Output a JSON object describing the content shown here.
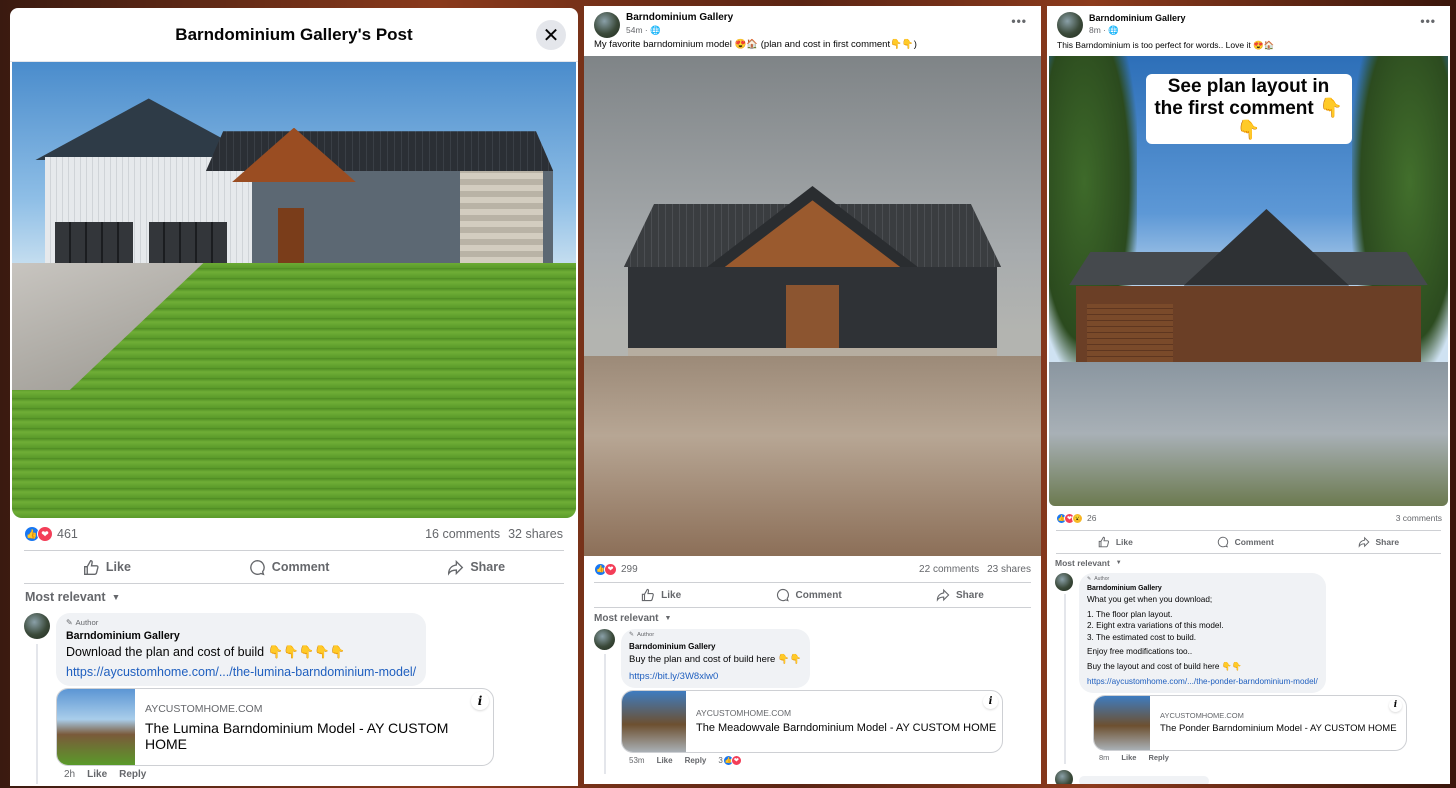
{
  "posts": [
    {
      "modal_title": "Barndominium Gallery's Post",
      "close_icon": "✕",
      "reactions": [
        "like",
        "love"
      ],
      "reaction_count": "461",
      "comments_count": "16 comments",
      "shares_count": "32 shares",
      "actions": {
        "like": "Like",
        "comment": "Comment",
        "share": "Share"
      },
      "sort_label": "Most relevant",
      "comment": {
        "badge": "Author",
        "author": "Barndominium Gallery",
        "text": "Download the plan and cost of build 👇👇👇👇👇",
        "link": "https://aycustomhome.com/.../the-lumina-barndominium-model/",
        "card": {
          "domain": "AYCUSTOMHOME.COM",
          "title": "The Lumina Barndominium Model - AY CUSTOM HOME",
          "info": "i"
        },
        "time": "2h",
        "like": "Like",
        "reply": "Reply"
      }
    },
    {
      "author": "Barndominium Gallery",
      "time": "54m",
      "privacy": "🌐",
      "more": "•••",
      "caption": "My favorite barndominium model 😍🏠  (plan and cost in first comment👇👇)",
      "reactions": [
        "like",
        "love"
      ],
      "reaction_count": "299",
      "comments_count": "22 comments",
      "shares_count": "23 shares",
      "actions": {
        "like": "Like",
        "comment": "Comment",
        "share": "Share"
      },
      "sort_label": "Most relevant",
      "comment": {
        "badge": "Author",
        "author": "Barndominium Gallery",
        "text": "Buy the plan and cost of build here 👇👇",
        "link": "https://bit.ly/3W8xlw0",
        "card": {
          "domain": "AYCUSTOMHOME.COM",
          "title": "The Meadowvale Barndominium Model - AY CUSTOM HOME",
          "info": "i"
        },
        "time": "53m",
        "like": "Like",
        "reply": "Reply",
        "reaction_count": "3"
      }
    },
    {
      "author": "Barndominium Gallery",
      "time": "8m",
      "privacy": "🌐",
      "more": "•••",
      "caption": "This Barndominium is too perfect for words.. Love it 😍🏠",
      "overlay_text": "See plan layout in the first comment 👇👇",
      "reactions": [
        "like",
        "love",
        "wow"
      ],
      "reaction_count": "26",
      "comments_count": "3 comments",
      "actions": {
        "like": "Like",
        "comment": "Comment",
        "share": "Share"
      },
      "sort_label": "Most relevant",
      "comment": {
        "badge": "Author",
        "author": "Barndominium Gallery",
        "lines": [
          "What you get when you download;",
          "1. The floor plan layout.",
          "2. Eight extra variations of this model.",
          "3. The estimated cost to build.",
          "Enjoy free modifications too..",
          "Buy the layout and cost of build here 👇👇"
        ],
        "link": "https://aycustomhome.com/.../the-ponder-barndominium-model/",
        "card": {
          "domain": "AYCUSTOMHOME.COM",
          "title": "The Ponder Barndominium Model - AY CUSTOM HOME",
          "info": "i"
        },
        "time": "8m",
        "like": "Like",
        "reply": "Reply"
      }
    }
  ],
  "icons": {
    "like": "👍",
    "love": "❤",
    "wow": "😮",
    "pencil": "✎",
    "caret": "▼"
  },
  "colors": {
    "facebook_blue": "#1877f2",
    "love_red": "#f33e58",
    "link_blue": "#1f5fbf",
    "bubble_gray": "#f0f2f5",
    "muted_text": "#65676b"
  }
}
